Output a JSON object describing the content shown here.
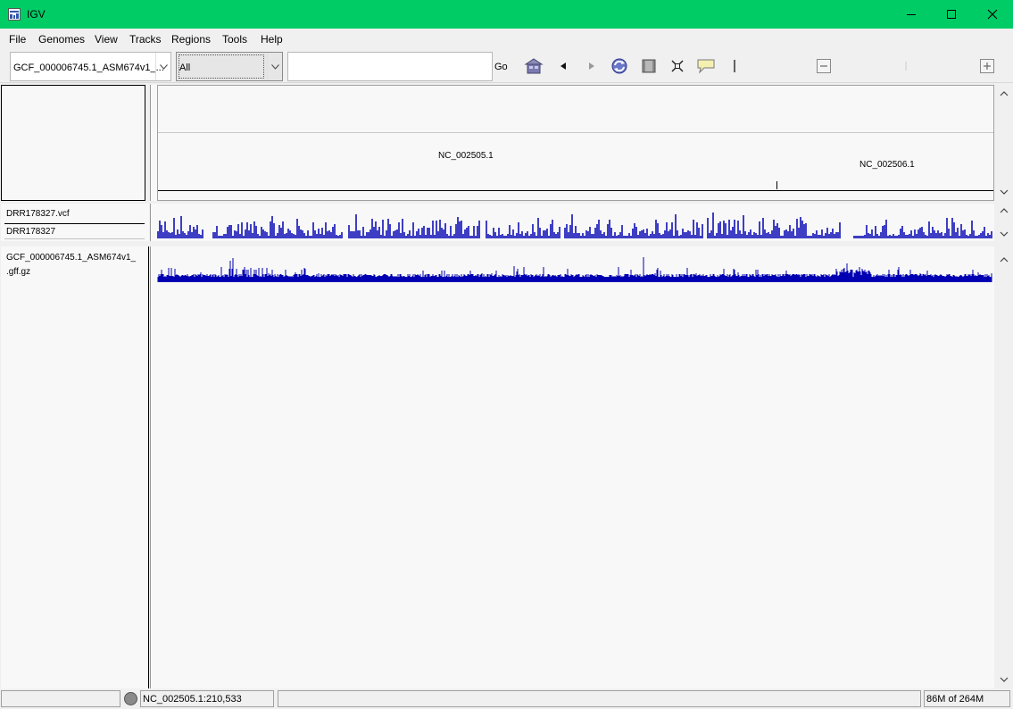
{
  "window": {
    "title": "IGV"
  },
  "menu": [
    "File",
    "Genomes",
    "View",
    "Tracks",
    "Regions",
    "Tools",
    "Help"
  ],
  "toolbar": {
    "genome_value": "GCF_000006745.1_ASM674v1_...",
    "chromosome_value": "All",
    "locus_value": "",
    "go_label": "Go"
  },
  "ideogram": {
    "chromosomes": [
      "NC_002505.1",
      "NC_002506.1"
    ]
  },
  "tracks": {
    "vcf_name": "DRR178327.vcf",
    "sample_name": "DRR178327",
    "gff_name_line1": "GCF_000006745.1_ASM674v1_",
    "gff_name_line2": ".gff.gz"
  },
  "colors": {
    "titlebar": "#00cc66",
    "data_track": "#0000b2",
    "panel_bg": "#f8f8f8"
  },
  "status": {
    "position": "NC_002505.1:210,533",
    "memory": "86M of 264M"
  },
  "icons": [
    "igv-app-icon",
    "minimize-icon",
    "maximize-icon",
    "close-icon",
    "home-icon",
    "back-icon",
    "forward-icon",
    "refresh-icon",
    "resize-icon",
    "select-region-icon",
    "popup-info-icon",
    "zoom-out-icon",
    "zoom-in-icon"
  ]
}
